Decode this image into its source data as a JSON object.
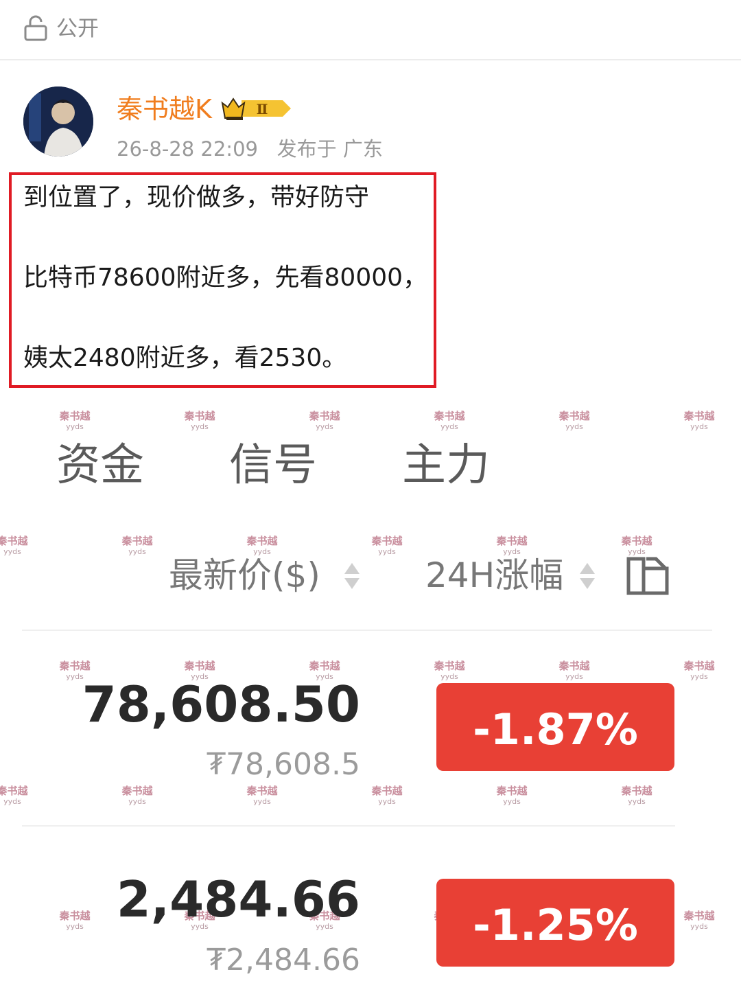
{
  "header": {
    "visibility_label": "公开",
    "lock_icon": "lock-open-icon"
  },
  "post": {
    "author": "秦书越K",
    "badge_text": "Ⅱ",
    "timestamp": "26-8-28 22:09",
    "location": "发布于 广东",
    "lines": [
      "到位置了，现价做多，带好防守",
      "比特币78600附近多，先看80000，",
      "姨太2480附近多，看2530。"
    ]
  },
  "market": {
    "tabs": [
      "资金",
      "信号",
      "主力"
    ],
    "columns": {
      "price": "最新价($)",
      "change": "24H涨幅"
    },
    "rows": [
      {
        "price": "78,608.50",
        "converted": "₮78,608.5",
        "change": "-1.87%"
      },
      {
        "price": "2,484.66",
        "converted": "₮2,484.66",
        "change": "-1.25%"
      }
    ],
    "watermark": {
      "line1": "秦书越",
      "line2": "yyds"
    }
  },
  "colors": {
    "accent_orange": "#f07d1e",
    "alert_red": "#e01b24",
    "down_red": "#e84035"
  }
}
